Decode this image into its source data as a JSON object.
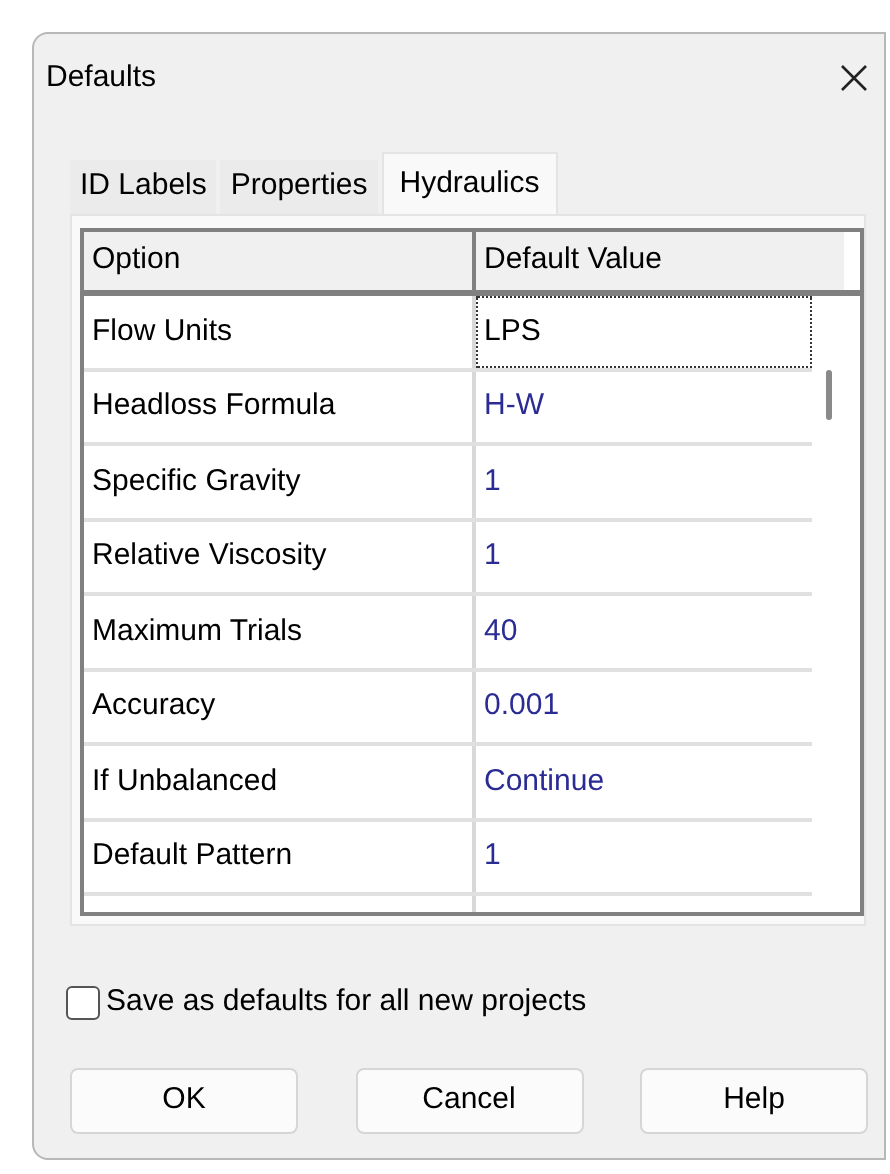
{
  "window": {
    "title": "Defaults"
  },
  "tabs": [
    {
      "label": "ID Labels",
      "selected": false
    },
    {
      "label": "Properties",
      "selected": false
    },
    {
      "label": "Hydraulics",
      "selected": true
    }
  ],
  "table": {
    "columns": [
      "Option",
      "Default Value"
    ],
    "rows": [
      {
        "option": "Flow Units",
        "value": "LPS",
        "focused": true
      },
      {
        "option": "Headloss Formula",
        "value": "H-W",
        "focused": false
      },
      {
        "option": "Specific Gravity",
        "value": "1",
        "focused": false
      },
      {
        "option": "Relative Viscosity",
        "value": "1",
        "focused": false
      },
      {
        "option": "Maximum Trials",
        "value": "40",
        "focused": false
      },
      {
        "option": "Accuracy",
        "value": "0.001",
        "focused": false
      },
      {
        "option": "If Unbalanced",
        "value": "Continue",
        "focused": false
      },
      {
        "option": "Default Pattern",
        "value": "1",
        "focused": false
      }
    ]
  },
  "save_defaults": {
    "label": "Save as defaults for all new projects",
    "checked": false
  },
  "buttons": [
    "OK",
    "Cancel",
    "Help"
  ]
}
